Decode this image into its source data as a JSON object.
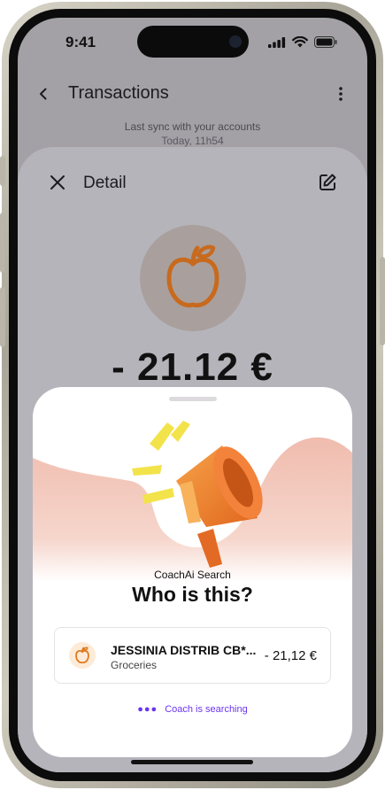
{
  "status_bar": {
    "time": "9:41"
  },
  "header": {
    "title": "Transactions"
  },
  "sync": {
    "label": "Last sync with your accounts",
    "time": "Today, 11h54"
  },
  "detail": {
    "title": "Detail",
    "amount": "- 21.12 €"
  },
  "coach": {
    "subtitle": "CoachAi Search",
    "title": "Who is this?",
    "status": "Coach is searching"
  },
  "transaction": {
    "name": "JESSINIA DISTRIB CB*...",
    "category": "Groceries",
    "amount": "- 21,12 €"
  },
  "colors": {
    "accent": "#c86a1e",
    "coach_status": "#6b35f0",
    "blob": "#f0bcae",
    "megaphone": "#f08a2e"
  },
  "icons": [
    "back-arrow-icon",
    "more-vertical-icon",
    "close-icon",
    "edit-icon",
    "apple-icon",
    "megaphone-icon",
    "signal-icon",
    "wifi-icon",
    "battery-icon"
  ]
}
